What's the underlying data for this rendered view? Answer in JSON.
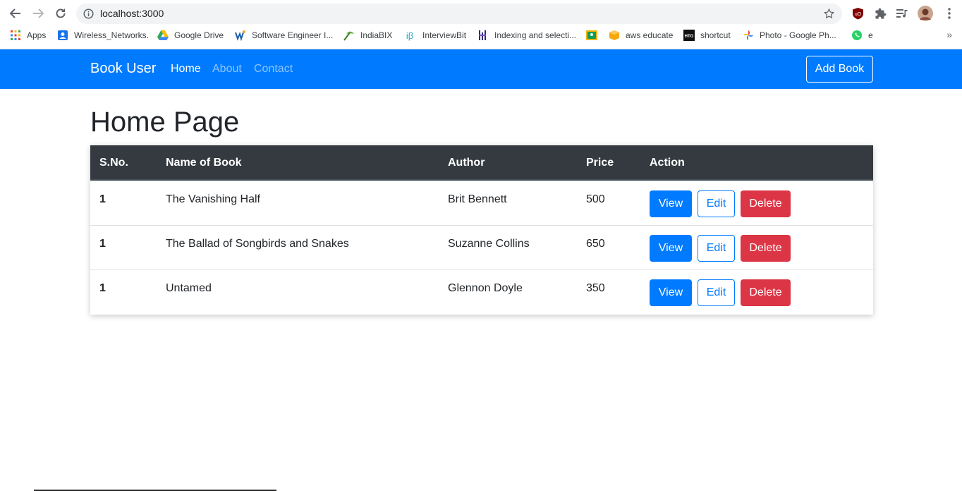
{
  "browser": {
    "url": "localhost:3000",
    "bookmarks": [
      {
        "label": "Apps",
        "icon": "apps-grid-icon"
      },
      {
        "label": "Wireless_Networks.",
        "icon": "contacts-icon"
      },
      {
        "label": "Google Drive",
        "icon": "google-drive-icon"
      },
      {
        "label": "Software Engineer I...",
        "icon": "w-logo-icon"
      },
      {
        "label": "IndiaBIX",
        "icon": "indiabix-icon"
      },
      {
        "label": "InterviewBit",
        "icon": "interviewbit-icon"
      },
      {
        "label": "Indexing and selecti...",
        "icon": "indexing-icon"
      },
      {
        "label": "",
        "icon": "classroom-icon"
      },
      {
        "label": "aws educate",
        "icon": "aws-box-icon"
      },
      {
        "label": "shortcut",
        "icon": "htg-icon"
      },
      {
        "label": "Photo - Google Ph...",
        "icon": "google-photos-icon"
      },
      {
        "label": "e",
        "icon": "whatsapp-icon"
      }
    ],
    "more_bookmarks": "»"
  },
  "navbar": {
    "brand": "Book User",
    "links": [
      "Home",
      "About",
      "Contact"
    ],
    "add_book": "Add Book",
    "color": "#007bff"
  },
  "page": {
    "title": "Home Page"
  },
  "table": {
    "headers": [
      "S.No.",
      "Name of Book",
      "Author",
      "Price",
      "Action"
    ],
    "rows": [
      {
        "sno": "1",
        "name": "The Vanishing Half",
        "author": "Brit Bennett",
        "price": "500"
      },
      {
        "sno": "1",
        "name": "The Ballad of Songbirds and Snakes",
        "author": "Suzanne Collins",
        "price": "650"
      },
      {
        "sno": "1",
        "name": "Untamed",
        "author": "Glennon Doyle",
        "price": "350"
      }
    ],
    "actions": {
      "view": "View",
      "edit": "Edit",
      "delete": "Delete"
    },
    "colors": {
      "view": "#007bff",
      "delete": "#dc3545",
      "header": "#343a40"
    }
  }
}
